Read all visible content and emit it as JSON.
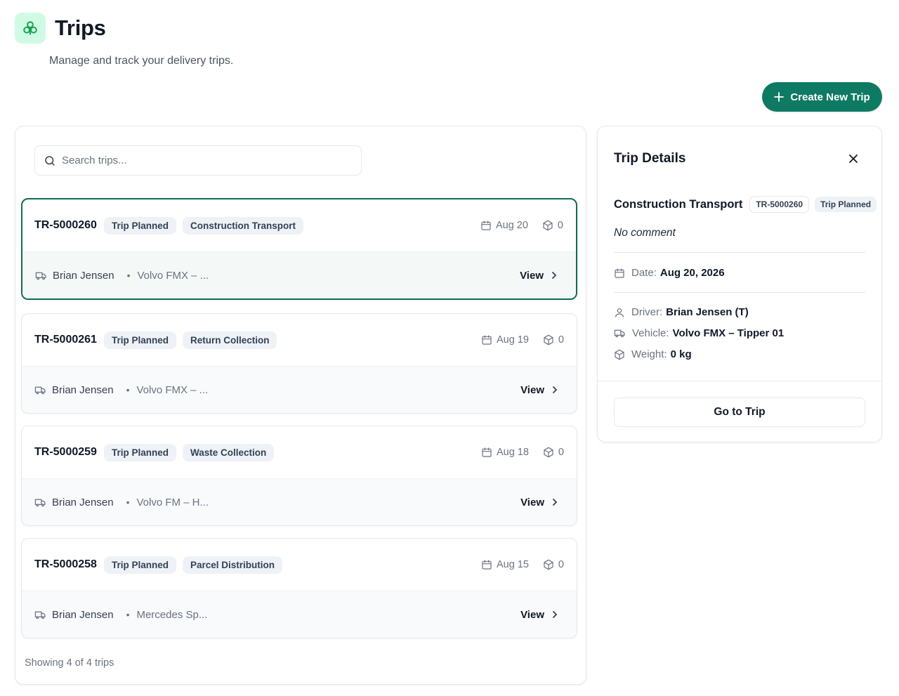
{
  "header": {
    "title": "Trips",
    "subtitle": "Manage and track your delivery trips.",
    "create_button": "Create New Trip"
  },
  "search": {
    "placeholder": "Search trips..."
  },
  "trips": [
    {
      "id": "TR-5000260",
      "status": "Trip Planned",
      "type": "Construction Transport",
      "date": "Aug 20",
      "packages": "0",
      "driver": "Brian Jensen",
      "vehicle": "Volvo FMX – ...",
      "action": "View"
    },
    {
      "id": "TR-5000261",
      "status": "Trip Planned",
      "type": "Return Collection",
      "date": "Aug 19",
      "packages": "0",
      "driver": "Brian Jensen",
      "vehicle": "Volvo FMX – ...",
      "action": "View"
    },
    {
      "id": "TR-5000259",
      "status": "Trip Planned",
      "type": "Waste Collection",
      "date": "Aug 18",
      "packages": "0",
      "driver": "Brian Jensen",
      "vehicle": "Volvo FM – H...",
      "action": "View"
    },
    {
      "id": "TR-5000258",
      "status": "Trip Planned",
      "type": "Parcel Distribution",
      "date": "Aug 15",
      "packages": "0",
      "driver": "Brian Jensen",
      "vehicle": "Mercedes Sp...",
      "action": "View"
    }
  ],
  "list_footer": "Showing 4 of 4 trips",
  "details": {
    "title": "Trip Details",
    "type": "Construction Transport",
    "id": "TR-5000260",
    "status": "Trip Planned",
    "comment": "No comment",
    "date_label": "Date:",
    "date_value": "Aug 20, 2026",
    "driver_label": "Driver:",
    "driver_value": "Brian Jensen (T)",
    "vehicle_label": "Vehicle:",
    "vehicle_value": "Volvo FMX – Tipper 01",
    "weight_label": "Weight:",
    "weight_value": "0 kg",
    "goto_button": "Go to Trip"
  },
  "colors": {
    "primary": "#0f7a63",
    "selected_border": "#0f6b55",
    "logo_bg": "#d1fae5",
    "badge_bg": "#eef2f7"
  },
  "icons": {
    "logo": "trefoil-logo-icon",
    "create": "plus-icon",
    "search": "search-icon",
    "date": "calendar-icon",
    "packages": "package-icon",
    "vehicle": "truck-icon",
    "view": "chevron-right-icon",
    "close": "close-icon",
    "driver": "user-icon"
  }
}
